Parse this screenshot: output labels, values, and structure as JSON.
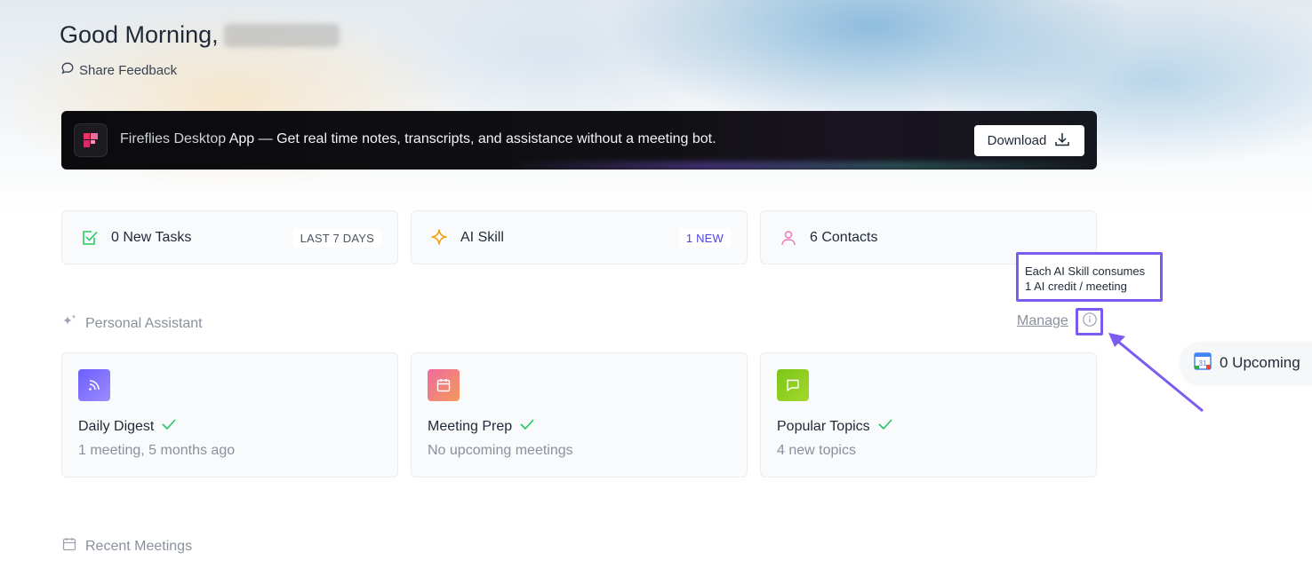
{
  "header": {
    "greeting": "Good Morning,",
    "feedback_label": "Share Feedback"
  },
  "banner": {
    "app_name": "Fireflies Desktop",
    "message": " App — Get real time notes, transcripts, and assistance without a meeting bot.",
    "download_label": "Download",
    "logo_color": "#e8325f"
  },
  "stats": [
    {
      "label": "0 New Tasks",
      "tag": "LAST 7 DAYS",
      "icon": "task-check-icon",
      "color": "#22c55e"
    },
    {
      "label": "AI Skill",
      "tag": "1 NEW",
      "icon": "sparkle-icon",
      "color": "#f59e0b"
    },
    {
      "label": "6 Contacts",
      "tag": "",
      "icon": "person-icon",
      "color": "#f472b6"
    }
  ],
  "tooltip": {
    "line1": "Each AI Skill consumes",
    "line2": "1 AI credit / meeting"
  },
  "personal_assistant": {
    "title": "Personal Assistant",
    "manage_label": "Manage",
    "cards": [
      {
        "title": "Daily Digest",
        "subtitle": "1 meeting, 5 months ago",
        "icon": "rss-icon",
        "color": "#6d5efc"
      },
      {
        "title": "Meeting Prep",
        "subtitle": "No upcoming meetings",
        "icon": "calendar-icon",
        "color": "#f26b83"
      },
      {
        "title": "Popular Topics",
        "subtitle": "4 new topics",
        "icon": "chat-icon",
        "color": "#84cc16"
      }
    ]
  },
  "upcoming": {
    "label": "0 Upcoming",
    "calendar_day": "31"
  },
  "recent": {
    "title": "Recent Meetings"
  },
  "colors": {
    "accent": "#7c5cf0",
    "check": "#22c55e"
  }
}
